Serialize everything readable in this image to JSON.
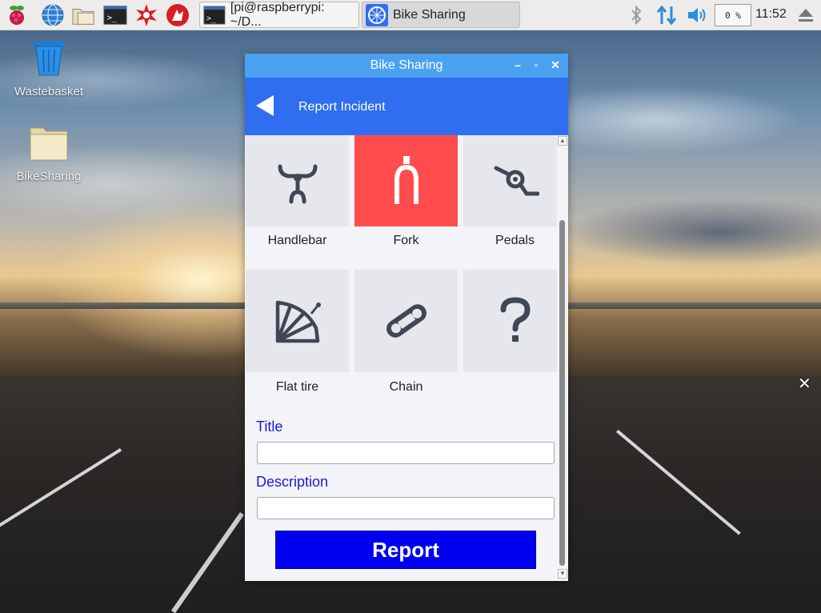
{
  "taskbar": {
    "tasks": [
      {
        "label": "[pi@raspberrypi: ~/D...",
        "icon": "terminal-icon"
      },
      {
        "label": "Bike Sharing",
        "icon": "bike-wheel-icon"
      }
    ],
    "cpu": "0 %",
    "clock": "11:52",
    "icons": [
      "raspberry-icon",
      "globe-icon",
      "folder-icon",
      "terminal-icon",
      "wolfram-icon",
      "mathematica-icon",
      "bluetooth-icon",
      "network-icon",
      "volume-icon",
      "eject-icon"
    ]
  },
  "desktop": {
    "icons": [
      {
        "label": "Wastebasket",
        "icon": "wastebasket-icon"
      },
      {
        "label": "BikeSharing",
        "icon": "folder-icon"
      }
    ]
  },
  "window": {
    "title": "Bike Sharing",
    "appbar_title": "Report Incident",
    "parts": [
      {
        "label": "Handlebar",
        "icon": "handlebar-icon",
        "selected": false
      },
      {
        "label": "Fork",
        "icon": "fork-icon",
        "selected": true
      },
      {
        "label": "Pedals",
        "icon": "pedals-icon",
        "selected": false
      },
      {
        "label": "Flat tire",
        "icon": "flat-tire-icon",
        "selected": false
      },
      {
        "label": "Chain",
        "icon": "chain-icon",
        "selected": false
      },
      {
        "label": "",
        "icon": "question-icon",
        "selected": false
      }
    ],
    "form": {
      "title_label": "Title",
      "title_value": "",
      "description_label": "Description",
      "description_value": "",
      "report_button": "Report"
    },
    "colors": {
      "appbar": "#2f6ef0",
      "selected_tile": "#ff4c4c",
      "report_button": "#0000f0",
      "form_label": "#1b19d8"
    }
  }
}
